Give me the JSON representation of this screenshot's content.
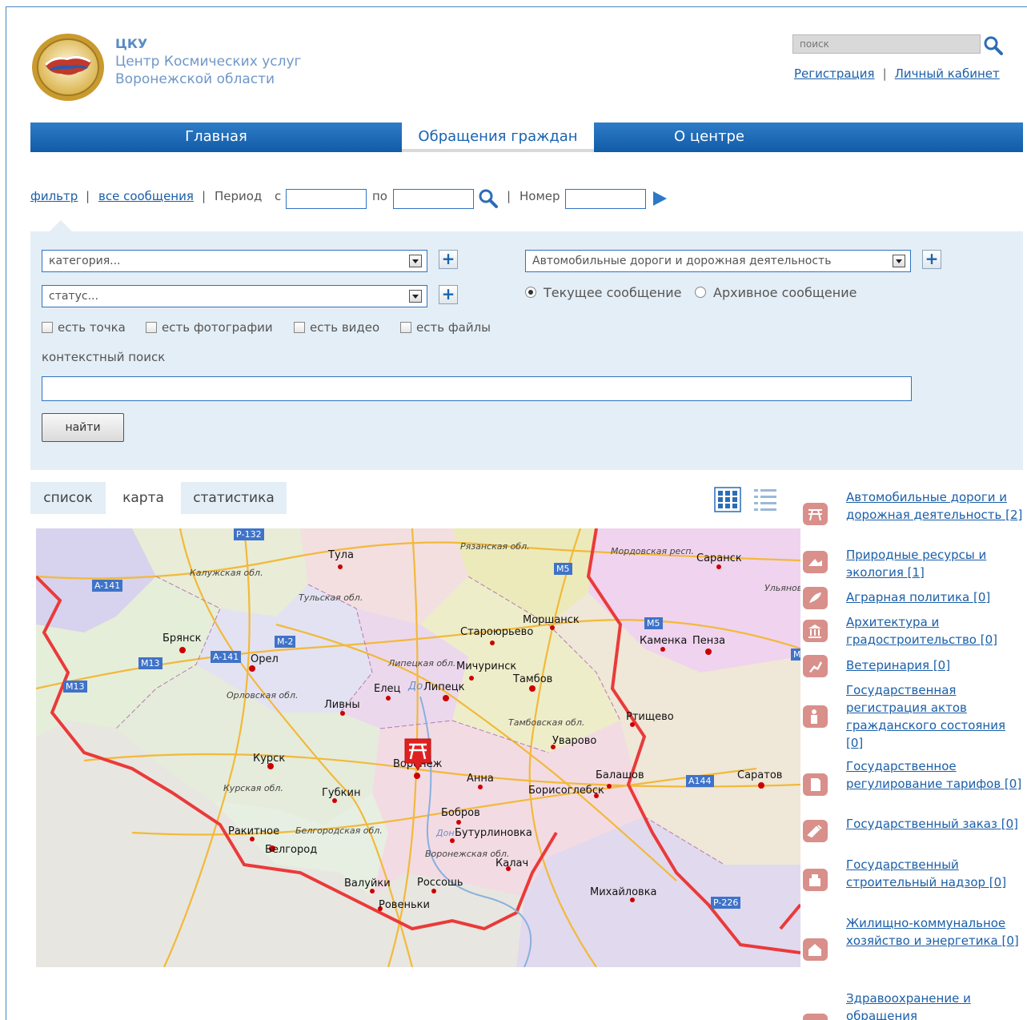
{
  "header": {
    "abbr": "ЦКУ",
    "name_line1": "Центр Космических услуг",
    "name_line2": "Воронежской области",
    "search_placeholder": "поиск",
    "register": "Регистрация",
    "sep": "|",
    "cabinet": "Личный кабинет"
  },
  "nav": {
    "items": [
      "Главная",
      "Обращения граждан",
      "О центре"
    ],
    "active_index": 1
  },
  "filter_bar": {
    "filter": "фильтр",
    "all_messages": "все сообщения",
    "period": "Период",
    "from": "с",
    "to": "по",
    "number": "Номер",
    "sep": "|"
  },
  "panel": {
    "category": "категория...",
    "status": "статус...",
    "category2": "Автомобильные дороги и дорожная деятельность",
    "radio_current": "Текущее сообщение",
    "radio_archive": "Архивное сообщение",
    "checks": [
      "есть точка",
      "есть фотографии",
      "есть видео",
      "есть файлы"
    ],
    "context_label": "контекстный поиск",
    "find": "найти"
  },
  "tabs": [
    "список",
    "карта",
    "статистика"
  ],
  "map": {
    "cities": [
      {
        "name": "Тула"
      },
      {
        "name": "Саранск"
      },
      {
        "name": "Брянск"
      },
      {
        "name": "Орел"
      },
      {
        "name": "Моршанск"
      },
      {
        "name": "Старою­рьево"
      },
      {
        "name": "Каменка"
      },
      {
        "name": "Пенза"
      },
      {
        "name": "Мичуринск"
      },
      {
        "name": "Тамбов"
      },
      {
        "name": "Елец"
      },
      {
        "name": "Липецк"
      },
      {
        "name": "Ливны"
      },
      {
        "name": "Ртищево"
      },
      {
        "name": "Уварово"
      },
      {
        "name": "Курск"
      },
      {
        "name": "Воронеж"
      },
      {
        "name": "Анна"
      },
      {
        "name": "Балашов"
      },
      {
        "name": "Саратов"
      },
      {
        "name": "Борисоглебск"
      },
      {
        "name": "Губкин"
      },
      {
        "name": "Бобров"
      },
      {
        "name": "Ракитное"
      },
      {
        "name": "Бутурлиновка"
      },
      {
        "name": "Белгород"
      },
      {
        "name": "Калач"
      },
      {
        "name": "Валуйки"
      },
      {
        "name": "Россошь"
      },
      {
        "name": "Михайловка"
      },
      {
        "name": "Ровеньки"
      }
    ],
    "regions": [
      "Калужская обл.",
      "Тульская обл.",
      "Рязанская обл.",
      "Мордовская респ.",
      "Ульяновск",
      "Липецкая обл.",
      "Орловская обл.",
      "Тамбовская обл.",
      "Курская обл.",
      "Белгородская обл.",
      "Воронежская обл.",
      "До",
      "Дон"
    ],
    "highways": [
      "Р-132",
      "A-141",
      "M5",
      "M-2",
      "M13",
      "A-141",
      "M13",
      "M5",
      "A144",
      "P-226",
      "M"
    ]
  },
  "categories": [
    "Автомобильные дороги и дорожная деятельность [2]",
    "Природные ресурсы и экология [1]",
    "Аграрная политика [0]",
    "Архитектура и градостроительство [0]",
    "Ветеринария [0]",
    "Государственная регистрация актов гражданского состояния [0]",
    "Государственное регулирование тарифов [0]",
    "Государственный заказ [0]",
    "Государственный строительный надзор [0]",
    "Жилищно-коммунальное хозяйство и энергетика [0]",
    "Здравоохранение и обращения"
  ],
  "colors": {
    "brand": "#1a63b0",
    "panel": "#e4eef6",
    "marker": "#e02020"
  }
}
